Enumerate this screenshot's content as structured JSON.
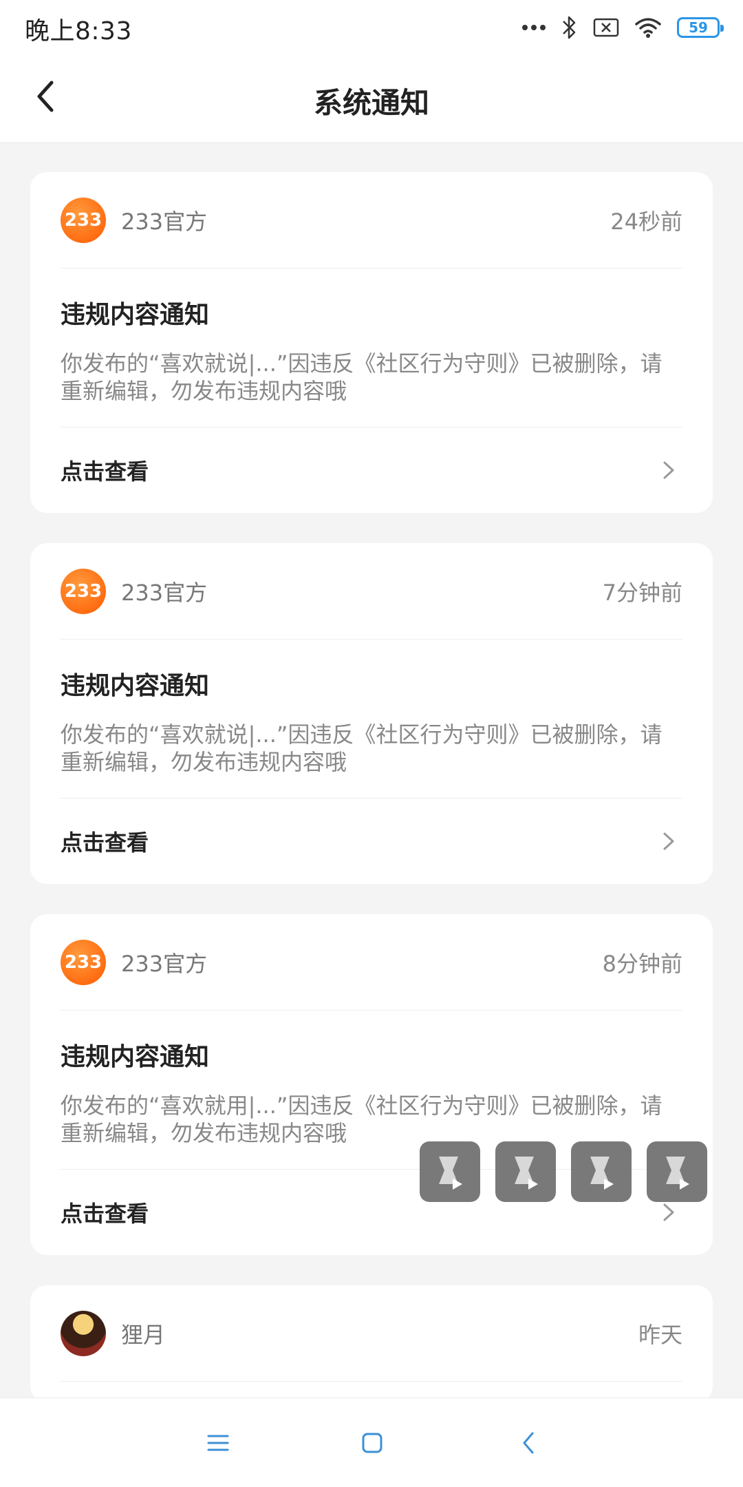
{
  "status_bar": {
    "time": "晚上8:33",
    "battery": "59",
    "accent_color": "#2a95e6"
  },
  "header": {
    "title": "系统通知",
    "back_icon": "chevron-left-icon"
  },
  "notifications": [
    {
      "sender": "233官方",
      "avatar_text": "233",
      "time": "24秒前",
      "title": "违规内容通知",
      "description": "你发布的“喜欢就说|...”因违反《社区行为守则》已被删除，请重新编辑，勿发布违规内容哦",
      "action": "点击查看"
    },
    {
      "sender": "233官方",
      "avatar_text": "233",
      "time": "7分钟前",
      "title": "违规内容通知",
      "description": "你发布的“喜欢就说|...”因违反《社区行为守则》已被删除，请重新编辑，勿发布违规内容哦",
      "action": "点击查看"
    },
    {
      "sender": "233官方",
      "avatar_text": "233",
      "time": "8分钟前",
      "title": "违规内容通知",
      "description": "你发布的“喜欢就用|...”因违反《社区行为守则》已被删除，请重新编辑，勿发布违规内容哦",
      "action": "点击查看"
    },
    {
      "sender": "狸月",
      "time": "昨天"
    }
  ],
  "nav_bar": {
    "menu_icon": "menu-icon",
    "home_icon": "home-square-icon",
    "back_icon": "back-icon"
  }
}
